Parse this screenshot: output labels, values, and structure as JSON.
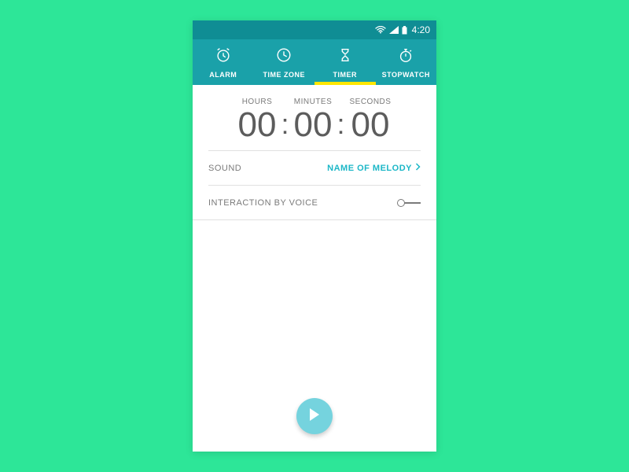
{
  "statusbar": {
    "time": "4:20"
  },
  "tabs": [
    {
      "label": "ALARM"
    },
    {
      "label": "TIME ZONE"
    },
    {
      "label": "TIMER"
    },
    {
      "label": "STOPWATCH"
    }
  ],
  "picker": {
    "hours_label": "HOURS",
    "minutes_label": "MINUTES",
    "seconds_label": "SECONDS",
    "hours": "00",
    "minutes": "00",
    "seconds": "00"
  },
  "sound_row": {
    "label": "SOUND",
    "value": "NAME OF MELODY"
  },
  "voice_row": {
    "label": "INTERACTION BY VOICE",
    "enabled": false
  }
}
